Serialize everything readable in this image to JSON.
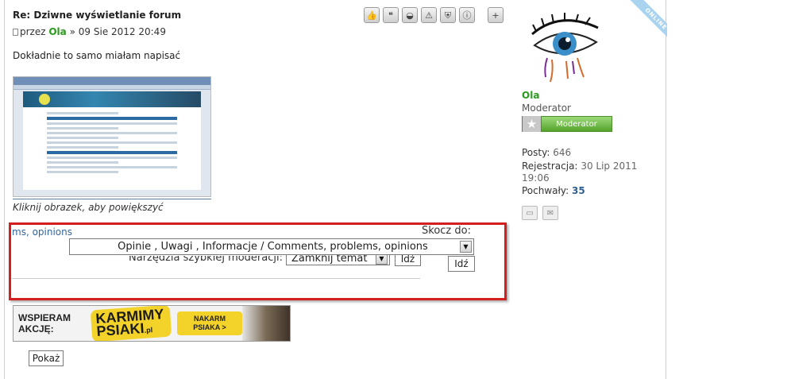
{
  "post": {
    "title": "Re: Dziwne wyświetlanie forum",
    "meta_prefix": "przez",
    "author": "Ola",
    "meta_sep": "»",
    "date": "09 Sie 2012 20:49",
    "body": "Dokładnie to samo miałam napisać",
    "image_caption": "Kliknij obrazek, aby powiększyć"
  },
  "post_buttons": [
    {
      "icon": "thumb-up-icon",
      "glyph": "👍"
    },
    {
      "icon": "quote-icon",
      "glyph": "❝"
    },
    {
      "icon": "helmet-icon",
      "glyph": "◒"
    },
    {
      "icon": "warning-icon",
      "glyph": "⚠"
    },
    {
      "icon": "shield-icon",
      "glyph": "⛨"
    },
    {
      "icon": "info-icon",
      "glyph": "ⓘ"
    },
    {
      "icon": "add-post-icon",
      "glyph": "+"
    }
  ],
  "user": {
    "status_ribbon": "ONLINE",
    "name": "Ola",
    "rank": "Moderator",
    "rank_badge": "Moderator",
    "posts_label": "Posty:",
    "posts_value": "646",
    "registered_label": "Rejestracja:",
    "registered_value": "30 Lip 2011",
    "registered_time": "19:06",
    "praise_label": "Pochwały:",
    "praise_value": "35"
  },
  "jump": {
    "forum_link": "ms, opinions",
    "label": "Skocz do:",
    "selected_forum": "Opinie , Uwagi , Informacje / Comments, problems, opinions",
    "button": "Idź"
  },
  "moderation": {
    "label": "Narzędzia szybkiej moderacji:",
    "selected": "Zamknij temat",
    "button": "Idź"
  },
  "banner": {
    "left_text_line1": "WSPIERAM",
    "left_text_line2": "AKCJĘ:",
    "logo_line1": "KARMIMY",
    "logo_line2": "PSIAKI",
    "logo_domain": ".pl",
    "cta_line1": "NAKARM",
    "cta_line2": "PSIAKA >"
  },
  "show_button": "Pokaż",
  "colors": {
    "author_green": "#2b9a1e",
    "highlight_red": "#d41f1f",
    "link_blue": "#3466a0"
  }
}
